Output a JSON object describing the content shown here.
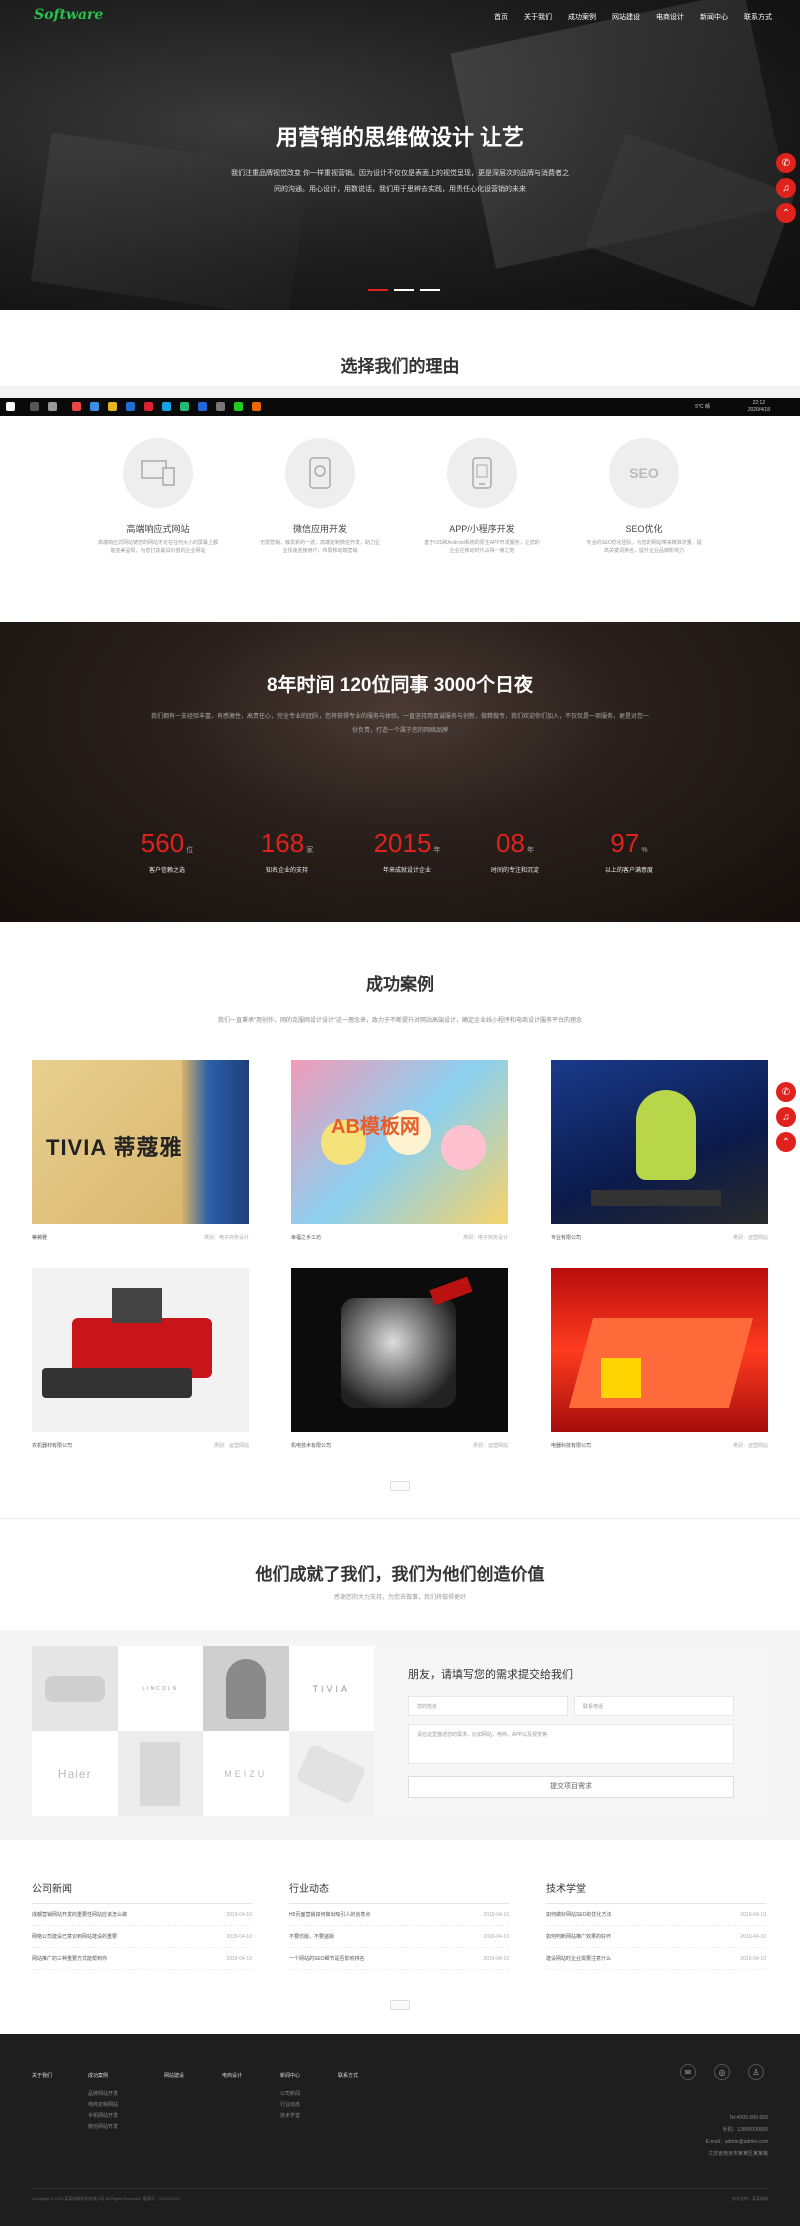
{
  "header": {
    "logo": "Software",
    "nav": [
      "首页",
      "关于我们",
      "成功案例",
      "网站建设",
      "电商设计",
      "新闻中心",
      "联系方式"
    ]
  },
  "hero": {
    "title": "用营销的思维做设计 让艺",
    "subtitle": "我们注重品牌视觉改变 你一样重视营销。因为设计不仅仅是表面上的视觉呈现，更是深层次的品牌与消费者之间的沟通。用心设计，用数说话，我们用于思辨去实践，用责任心化设营销的未来",
    "accent": "#e0221c"
  },
  "side_buttons": [
    "phone-icon",
    "bell-icon",
    "chevron-up-icon"
  ],
  "reasons": {
    "title": "选择我们的理由",
    "items": [
      {
        "title": "高端响应式网站",
        "desc": "高端响应式网站使您的网站无论在任何大小的屏幕上都能完美呈现，为您打造最具价值的企业网站",
        "icon": "devices-icon"
      },
      {
        "title": "微信应用开发",
        "desc": "无限营销，触发新的一波，高端定制微信开发，助力企业快速连接用户，布局移动端营销",
        "icon": "wechat-app-icon"
      },
      {
        "title": "APP/小程序开发",
        "desc": "基于iOS和Android系统的原生APP开发服务，让您的企业在移动时代占得一席之地",
        "icon": "phone-app-icon"
      },
      {
        "title": "SEO优化",
        "desc": "专业的SEO优化团队，为您的网站带来精准流量，提高关键词排名，提升企业品牌影响力",
        "icon": "seo-icon",
        "label": "SEO"
      }
    ]
  },
  "taskbar": {
    "time": "22:12",
    "date": "2020/4/18",
    "status": "5°C 晴"
  },
  "stats": {
    "title": "8年时间  120位同事  3000个日夜",
    "subtitle": "我们拥有一支经验丰富，有感激性，高责任心，完全专业的团队，您将获得专业的服务与体验。一直坚持用真诚服务与创新，做精做专，我们欢迎你们加入，不仅仅是一项服务，更是对您一份负责，打造一个属于您的网络品牌",
    "items": [
      {
        "num": "560",
        "unit": "位",
        "label": "客户信赖之选"
      },
      {
        "num": "168",
        "unit": "家",
        "label": "知名企业的支持"
      },
      {
        "num": "2015",
        "unit": "年",
        "label": "年来成就设计企业"
      },
      {
        "num": "08",
        "unit": "年",
        "label": "时间的专注和沉淀"
      },
      {
        "num": "97",
        "unit": "%",
        "label": "以上的客户满意度"
      }
    ]
  },
  "cases": {
    "title": "成功案例",
    "subtitle": "我们一直秉承“用创作，网的克服网设计设计”这一理念来，致力于不断提升对网站高端设计，确定企业线小程序和电商设计服务平台的理念",
    "items": [
      {
        "name": "蒂薇雅",
        "tag": "类别：电子商务设计"
      },
      {
        "name": "幸福之手工坊",
        "tag": "类别：电子商务设计"
      },
      {
        "name": "专业有限公司",
        "tag": "类别：运营网站"
      },
      {
        "name": "农机器材有限公司",
        "tag": "类别：运营网站"
      },
      {
        "name": "机电技术有限公司",
        "tag": "类别：运营网站"
      },
      {
        "name": "电器科技有限公司",
        "tag": "类别：运营网站"
      }
    ],
    "brand_text": "TIVIA 蒂蔻雅",
    "watermark": "AB模板网"
  },
  "clients": {
    "title": "他们成就了我们，我们为他们创造价值",
    "subtitle": "感谢您的大力支持，为您去做事，我们将做得更好",
    "brands": [
      "",
      "LINCOLN",
      "",
      "TIVIA",
      "Haier",
      "",
      "MEIZU",
      ""
    ],
    "form": {
      "title": "朋友，请填写您的需求提交给我们",
      "name_ph": "您的姓名",
      "phone_ph": "联系电话",
      "msg_ph": "请在这里描述您的需求，比如网站，电商，APP以及视觉等",
      "submit": "提交项目需求"
    }
  },
  "news": [
    {
      "title": "公司新闻",
      "rows": [
        {
          "t": "成都营销网站开发的重要性网站应该怎么做",
          "d": "2019-04-10"
        },
        {
          "t": "网络公司建设已意识到网站建设的重要",
          "d": "2019-04-10"
        },
        {
          "t": "网站推广的三种重要方式能帮到你",
          "d": "2019-04-10"
        }
      ]
    },
    {
      "title": "行业动态",
      "rows": [
        {
          "t": "H5页面营销如何做出吸引人的创意点",
          "d": "2019-04-10"
        },
        {
          "t": "不要仿版，不要盗版",
          "d": "2019-04-10"
        },
        {
          "t": "一个网站的SEO细节是否影响排名",
          "d": "2019-04-10"
        }
      ]
    },
    {
      "title": "技术学堂",
      "rows": [
        {
          "t": "如何做好网站SEO的优化方法",
          "d": "2019-04-10"
        },
        {
          "t": "如何判断网站推广效果的好坏",
          "d": "2019-04-10"
        },
        {
          "t": "建设网站时企业需要注意什么",
          "d": "2019-04-10"
        }
      ]
    }
  ],
  "footer": {
    "cols": [
      {
        "h": "关于我们",
        "items": []
      },
      {
        "h": "成功案例",
        "items": [
          "品牌网站开发",
          "电商定制网站",
          "手机网站开发",
          "微信网站开发"
        ]
      },
      {
        "h": "网站建设",
        "items": []
      },
      {
        "h": "电商设计",
        "items": []
      },
      {
        "h": "新闻中心",
        "items": [
          "公司新闻",
          "行业动态",
          "技术学堂"
        ]
      },
      {
        "h": "联系方式",
        "items": []
      }
    ],
    "contact": [
      "Tel:4000-000-000",
      "手机：13800000000",
      "E-mail：admin@admin.com",
      "江苏省南京市某某区某某路"
    ],
    "copyright": "Copyright © 2019 某某网络科技有限公司 All Rights Reserved. 备案号：XXXXXXXX",
    "copy_right": "技术支持：某某网络"
  }
}
